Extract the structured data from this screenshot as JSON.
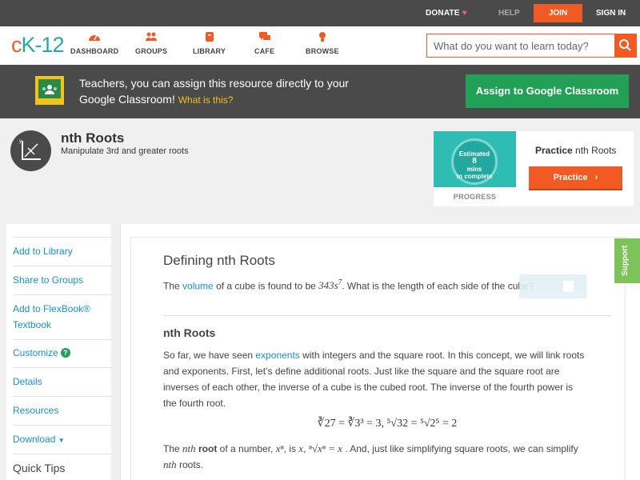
{
  "topbar": {
    "donate": "DONATE",
    "help": "HELP",
    "join": "JOIN",
    "signin": "SIGN IN"
  },
  "logo": {
    "text_c": "c",
    "text_k": "K",
    "text_n": "-12"
  },
  "nav": {
    "items": [
      {
        "label": "DASHBOARD",
        "icon": "dashboard-icon"
      },
      {
        "label": "GROUPS",
        "icon": "groups-icon"
      },
      {
        "label": "LIBRARY",
        "icon": "library-icon"
      },
      {
        "label": "CAFE",
        "icon": "cafe-icon"
      },
      {
        "label": "BROWSE",
        "icon": "browse-icon"
      }
    ],
    "search_placeholder": "What do you want to learn today?"
  },
  "banner": {
    "message": "Teachers, you can assign this resource directly to your Google Classroom!",
    "what_link": "What is this?",
    "assign_button": "Assign to Google Classroom"
  },
  "concept": {
    "title": "nth Roots",
    "subtitle": "Manipulate 3rd and greater roots",
    "estimate_line1": "Estimated",
    "estimate_line2": "8",
    "estimate_line3": "mins",
    "estimate_line4": "to complete",
    "progress_label": "PROGRESS",
    "practice_bold": "Practice",
    "practice_rest": "nth Roots",
    "practice_button": "Practice"
  },
  "sidebar": {
    "items": [
      "Add to Library",
      "Share to Groups",
      "Add to FlexBook® Textbook",
      "Customize",
      "Details",
      "Resources",
      "Download"
    ],
    "quick_tips": "Quick Tips"
  },
  "content": {
    "heading": "Defining nth Roots",
    "q_pre": "The",
    "q_link": "volume",
    "q_mid": "of a cube is found to be",
    "q_math": "343s",
    "q_exp": "7",
    "q_post": ". What is the length of each side of the cube?",
    "subheading": "nth Roots",
    "para1_pre": "So far, we have seen",
    "para1_link": "exponents",
    "para1_post": "with integers and the square root. In this concept, we will link roots and exponents. First, let’s define additional roots. Just like the square and the square root are inverses of each other, the inverse of a cube is the cubed root. The inverse of the fourth power is the fourth root.",
    "equation": "∛27 = ∛3³ = 3, ⁵√32 = ⁵√2⁵ = 2",
    "para2_a": "The",
    "para2_nth": "nth",
    "para2_root": "root",
    "para2_b": "of a number,",
    "para2_xn": "xⁿ",
    "para2_c": ", is",
    "para2_x": "x",
    "para2_d": ",",
    "para2_rad": "ⁿ√xⁿ = x",
    "para2_e": ". And, just like simplifying square roots, we can",
    "para2_f": "simplify",
    "para2_nth2": "nth",
    "para2_g": "roots."
  },
  "support": {
    "label": "Support"
  }
}
